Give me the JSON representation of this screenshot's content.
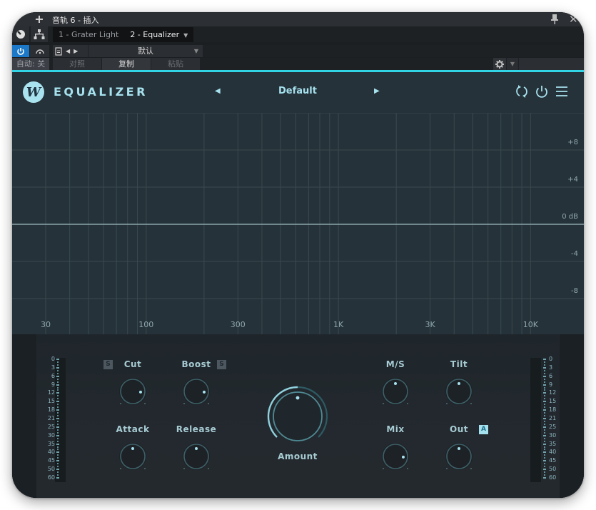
{
  "host": {
    "title": "音轨 6 - 插入",
    "add_icon": "plus-icon",
    "pin_icon": "pin-icon",
    "close_icon": "close-icon",
    "tabs": [
      {
        "label": "1 - Grater Light",
        "active": false
      },
      {
        "label": "2 - Equalizer",
        "active": true
      }
    ],
    "preset": "默认",
    "auto_label": "自动: 关",
    "compare_label": "对照",
    "copy_label": "复制",
    "paste_label": "粘贴",
    "accent_color": "#31d4e4",
    "power_color": "#1c78c8"
  },
  "plugin": {
    "brand": "EQUALIZER",
    "logo_glyph": "W",
    "preset_name": "Default",
    "prev_glyph": "◀",
    "next_glyph": "▶",
    "accent_color": "#a6e1ee",
    "header_icons": [
      "sync-icon",
      "power-icon",
      "menu-icon"
    ]
  },
  "graph": {
    "freq_labels": [
      {
        "label": "30",
        "hz": 30
      },
      {
        "label": "100",
        "hz": 100
      },
      {
        "label": "300",
        "hz": 300
      },
      {
        "label": "1K",
        "hz": 1000
      },
      {
        "label": "3K",
        "hz": 3000
      },
      {
        "label": "10K",
        "hz": 10000
      }
    ],
    "freq_gridlines_hz": [
      30,
      40,
      50,
      60,
      70,
      80,
      90,
      100,
      200,
      300,
      400,
      500,
      600,
      700,
      800,
      900,
      1000,
      2000,
      3000,
      4000,
      5000,
      6000,
      7000,
      8000,
      9000,
      10000
    ],
    "db_labels": [
      {
        "label": "+8",
        "db": 8
      },
      {
        "label": "+4",
        "db": 4
      },
      {
        "label": "0 dB",
        "db": 0
      },
      {
        "label": "-4",
        "db": -4
      },
      {
        "label": "-8",
        "db": -8
      }
    ],
    "db_gridlines": [
      12,
      8,
      4,
      0,
      -4,
      -8,
      -12
    ],
    "curve_db": 0
  },
  "meters": {
    "ticks": [
      "0",
      "3",
      "6",
      "9",
      "12",
      "15",
      "18",
      "21",
      "25",
      "30",
      "35",
      "40",
      "45",
      "50",
      "60"
    ]
  },
  "knobs": {
    "cut": {
      "label": "Cut",
      "solo": "S",
      "value": 0.85
    },
    "boost": {
      "label": "Boost",
      "solo": "S",
      "value": 0.85
    },
    "attack": {
      "label": "Attack",
      "value": 0.5
    },
    "release": {
      "label": "Release",
      "value": 0.5
    },
    "amount": {
      "label": "Amount",
      "value": 0.5
    },
    "ms": {
      "label": "M/S",
      "value": 0.5
    },
    "tilt": {
      "label": "Tilt",
      "value": 0.5
    },
    "mix": {
      "label": "Mix",
      "value": 0.85
    },
    "out": {
      "label": "Out",
      "auto": "A",
      "value": 0.5
    }
  }
}
